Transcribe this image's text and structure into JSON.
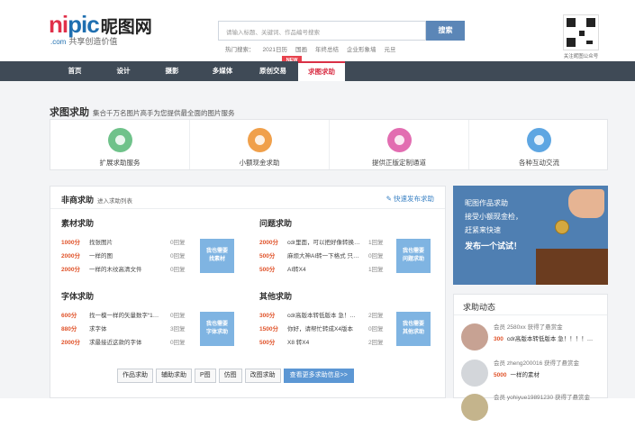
{
  "logo": {
    "part1": "ni",
    "part2": "pic",
    "cn": "昵图网",
    "sub1": ".com",
    "sub2": "共享创造价值"
  },
  "search": {
    "placeholder": "请输入标题、关键词、作品编号搜索",
    "button": "搜索"
  },
  "hot": {
    "label": "热门搜索：",
    "items": [
      "2021日历",
      "国画",
      "年终总结",
      "企业形象墙",
      "元旦"
    ]
  },
  "qr": {
    "caption": "关注昵图公众号"
  },
  "nav": {
    "items": [
      "首页",
      "设计",
      "摄影",
      "多媒体",
      "原创交易",
      "求图求助"
    ],
    "new_badge": "NEW",
    "active": "求图求助"
  },
  "section": {
    "title": "求图求助",
    "subtitle": "集合千万名图片高手为您提供最全面的图片服务"
  },
  "services": [
    {
      "label": "扩展求助服务",
      "icon": "heart-plus-icon",
      "color": "#6fc28a"
    },
    {
      "label": "小额现金求助",
      "icon": "money-bag-icon",
      "color": "#f0a04b"
    },
    {
      "label": "提供正版定制通道",
      "icon": "clipboard-icon",
      "color": "#e26db1"
    },
    {
      "label": "各种互动交流",
      "icon": "chat-bubble-icon",
      "color": "#5ea6e2"
    }
  ],
  "panel": {
    "title": "非商求助",
    "subtitle": "进入求助列表",
    "publish": "快速发布求助"
  },
  "categories": [
    {
      "title": "素材求助",
      "button": [
        "我也需要",
        "找素材"
      ],
      "rows": [
        {
          "points": "1000分",
          "text": "找张图片",
          "replies": "0回复"
        },
        {
          "points": "2000分",
          "text": "一样的图",
          "replies": "0回复"
        },
        {
          "points": "2000分",
          "text": "一样的木纹高清文件",
          "replies": "0回复"
        }
      ]
    },
    {
      "title": "问题求助",
      "button": [
        "我也需要",
        "问题求助"
      ],
      "rows": [
        {
          "points": "2000分",
          "text": "cdr里面，可以把好像转换…",
          "replies": "1回复"
        },
        {
          "points": "500分",
          "text": "麻烦大神AI转一下格式 只…",
          "replies": "0回复"
        },
        {
          "points": "500分",
          "text": "AI转X4",
          "replies": "1回复"
        }
      ]
    },
    {
      "title": "字体求助",
      "button": [
        "我也需要",
        "字体求助"
      ],
      "rows": [
        {
          "points": "600分",
          "text": "找一模一样的矢量数字“1…",
          "replies": "0回复"
        },
        {
          "points": "880分",
          "text": "求字体",
          "replies": "3回复"
        },
        {
          "points": "2000分",
          "text": "求最接近这款的字体",
          "replies": "0回复"
        }
      ]
    },
    {
      "title": "其他求助",
      "button": [
        "我也需要",
        "其他求助"
      ],
      "rows": [
        {
          "points": "300分",
          "text": "cdr高版本转低版本 急！…",
          "replies": "2回复"
        },
        {
          "points": "1500分",
          "text": "你好，请帮忙转成X4版本",
          "replies": "0回复"
        },
        {
          "points": "500分",
          "text": "X8 转X4",
          "replies": "2回复"
        }
      ]
    }
  ],
  "bottom_tabs": [
    "作品求助",
    "辅助求助",
    "P图",
    "仿图",
    "改图求助"
  ],
  "more": "查看更多求助信息>>",
  "banner": {
    "lines": [
      "昵图作品求助",
      "接受小额现金检，",
      "赶紧来快速",
      "发布一个试试！"
    ]
  },
  "dynamics": {
    "title": "求助动态",
    "items": [
      {
        "user": "会员",
        "name": "2580xx",
        "action": "获得了悬赏金",
        "points": "300",
        "text": "cdr高版本转低版本 急！！！！…"
      },
      {
        "user": "会员",
        "name": "zheng200016",
        "action": "获得了悬赏金",
        "points": "5000",
        "text": "一样的素材"
      },
      {
        "user": "会员",
        "name": "yohiyue19891230",
        "action": "获得了悬赏金",
        "points": "",
        "text": ""
      }
    ]
  }
}
